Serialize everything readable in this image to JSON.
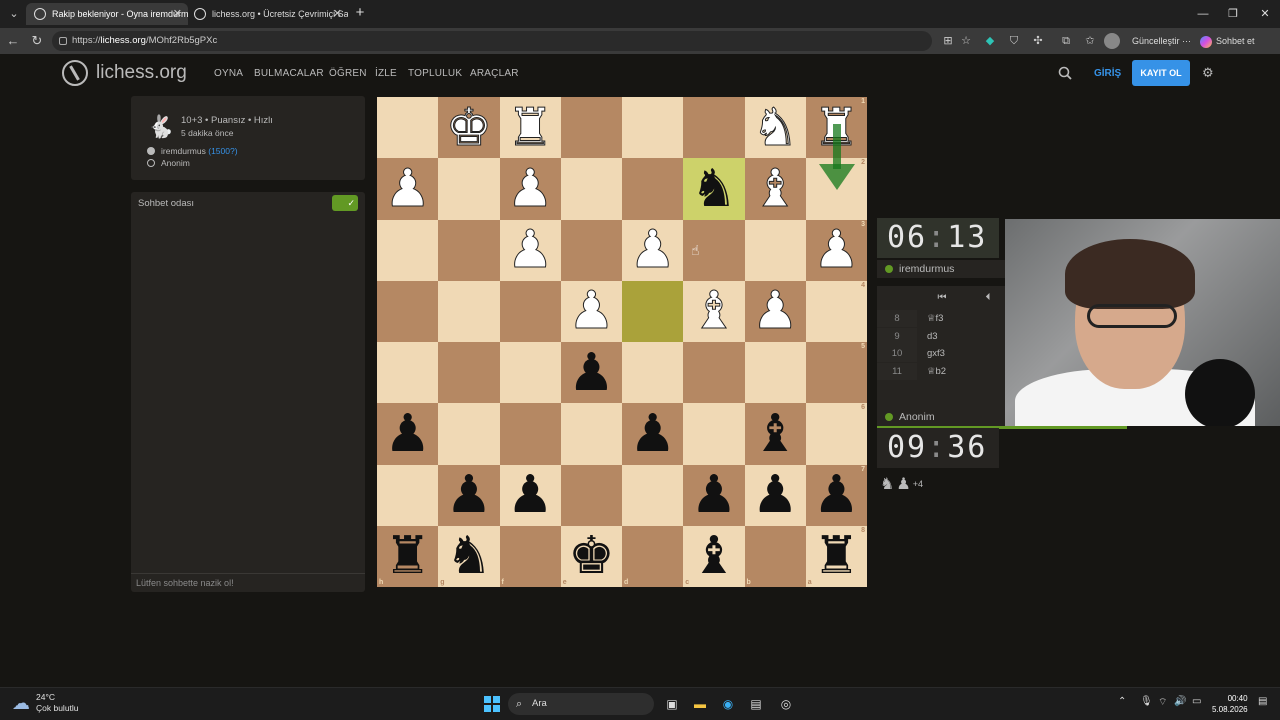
{
  "browser": {
    "tabs": [
      {
        "title": "Rakip bekleniyor - Oyna iremdurm"
      },
      {
        "title": "lichess.org • Ücretsiz Çevrimiçi Sa"
      }
    ],
    "url_prefix": "https://",
    "url_host": "lichess.org",
    "url_path": "/MOhf2Rb5gPXc",
    "update_label": "Güncelleştir",
    "chat_label": "Sohbet et"
  },
  "site": {
    "logo": "lichess.org",
    "nav": [
      "OYNA",
      "BULMACALAR",
      "ÖĞREN",
      "İZLE",
      "TOPLULUK",
      "ARAÇLAR"
    ],
    "login": "GİRİŞ",
    "signup": "KAYIT OL"
  },
  "game_info": {
    "title": "10+3 • Puansız • Hızlı",
    "time_ago": "5 dakika önce",
    "player1_name": "iremdurmus",
    "player1_rating": "(1500?)",
    "player2_name": "Anonim"
  },
  "chat": {
    "title": "Sohbet odası",
    "placeholder": "Lütfen sohbette nazik ol!"
  },
  "board": {
    "orientation": "black",
    "ranks": [
      "1",
      "2",
      "3",
      "4",
      "5",
      "6",
      "7",
      "8"
    ],
    "files": [
      "h",
      "g",
      "f",
      "e",
      "d",
      "c",
      "b",
      "a"
    ],
    "rows": [
      [
        "",
        "wK",
        "wR",
        "",
        "",
        "",
        "wN",
        "wR"
      ],
      [
        "wP",
        "",
        "wP",
        "",
        "",
        "bN",
        "wB",
        ""
      ],
      [
        "",
        "",
        "wP",
        "",
        "wP",
        "",
        "",
        "wP"
      ],
      [
        "",
        "",
        "",
        "wP",
        "",
        "wB",
        "wP",
        ""
      ],
      [
        "",
        "",
        "",
        "bP",
        "",
        "",
        "",
        ""
      ],
      [
        "bP",
        "",
        "",
        "",
        "bP",
        "",
        "bB",
        ""
      ],
      [
        "",
        "bP",
        "bP",
        "",
        "",
        "bP",
        "bP",
        "bP"
      ],
      [
        "bR",
        "bN",
        "",
        "bK",
        "",
        "bB",
        "",
        "bR"
      ]
    ],
    "highlights": [
      [
        1,
        5
      ],
      [
        3,
        4
      ]
    ]
  },
  "clocks": {
    "top_min": "06",
    "top_sec": "13",
    "bottom_min": "09",
    "bottom_sec": "36",
    "top_player": "iremdurmus",
    "bottom_player": "Anonim"
  },
  "moves": [
    {
      "num": "8",
      "move": "♕f3"
    },
    {
      "num": "9",
      "move": "d3"
    },
    {
      "num": "10",
      "move": "gxf3"
    },
    {
      "num": "11",
      "move": "♕b2"
    }
  ],
  "captured": {
    "extra": "+4"
  },
  "taskbar": {
    "temp": "24°C",
    "weather": "Çok bulutlu",
    "search": "Ara",
    "time": "00:40",
    "date": "5.08.2026"
  },
  "colors": {
    "accent": "#3692e7",
    "green": "#629924",
    "light_square": "#f0d9b5",
    "dark_square": "#b58863"
  }
}
